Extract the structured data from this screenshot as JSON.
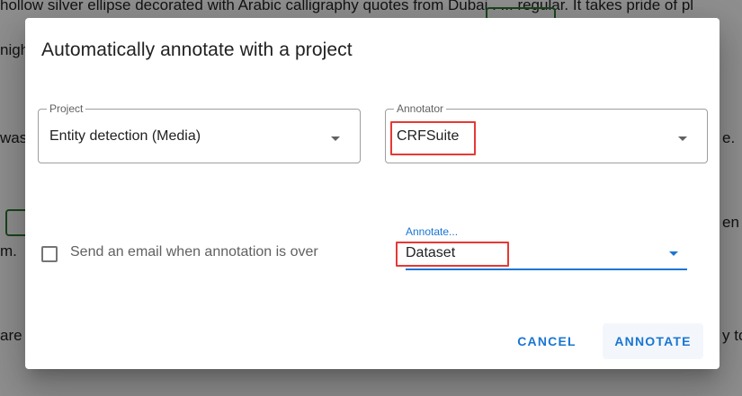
{
  "background": {
    "lines": [
      "hollow silver ellipse decorated with Arabic calligraphy quotes from Dubai . ... regular. It takes pride of pl",
      "nigh",
      "was",
      "m.",
      "are y"
    ],
    "right_fragments": [
      "e.",
      "en c",
      "y to"
    ],
    "chips": [
      "Dubai",
      "D"
    ]
  },
  "dialog": {
    "title": "Automatically annotate with a project",
    "project_field": {
      "label": "Project",
      "value": "Entity detection (Media)"
    },
    "annotator_field": {
      "label": "Annotator",
      "value": "CRFSuite"
    },
    "email_checkbox": {
      "label": "Send an email when annotation is over",
      "checked": false
    },
    "annotate_field": {
      "label": "Annotate...",
      "value": "Dataset"
    },
    "buttons": {
      "cancel": "CANCEL",
      "annotate": "ANNOTATE"
    }
  },
  "colors": {
    "primary": "#1976d2",
    "highlight_box": "#e53935",
    "chip_border": "#2e7d32"
  }
}
